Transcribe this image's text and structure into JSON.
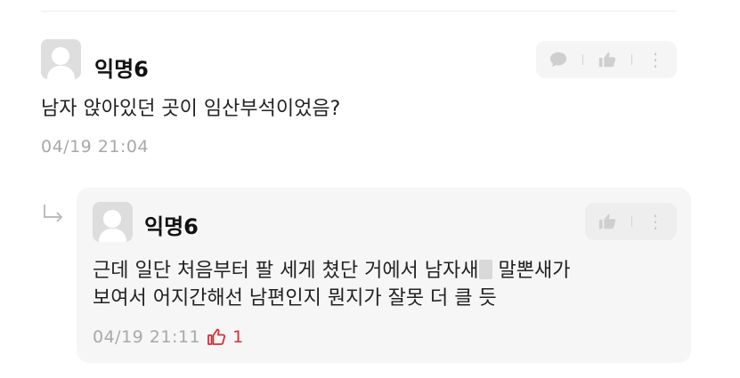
{
  "comment": {
    "nickname": "익명6",
    "text": "남자 앉아있던 곳이 임산부석이었음?",
    "timestamp": "04/19 21:04",
    "actions": [
      "comment-icon",
      "thumbs-up-icon",
      "more-vertical-icon"
    ]
  },
  "reply": {
    "nickname": "익명6",
    "text_line1_before": "근데 일단 처음부터 팔 세게 쳤단 거에서 남자새",
    "text_line1_after": " 말뽄새가",
    "text_line2": "보여서 어지간해선 남편인지 뭔지가 잘못 더 클 듯",
    "timestamp": "04/19 21:11",
    "like_count": "1",
    "actions": [
      "thumbs-up-icon",
      "more-vertical-icon"
    ]
  },
  "colors": {
    "like_red": "#d0323c",
    "muted_text": "#a8a8a8",
    "reply_bg": "#f6f6f6"
  }
}
